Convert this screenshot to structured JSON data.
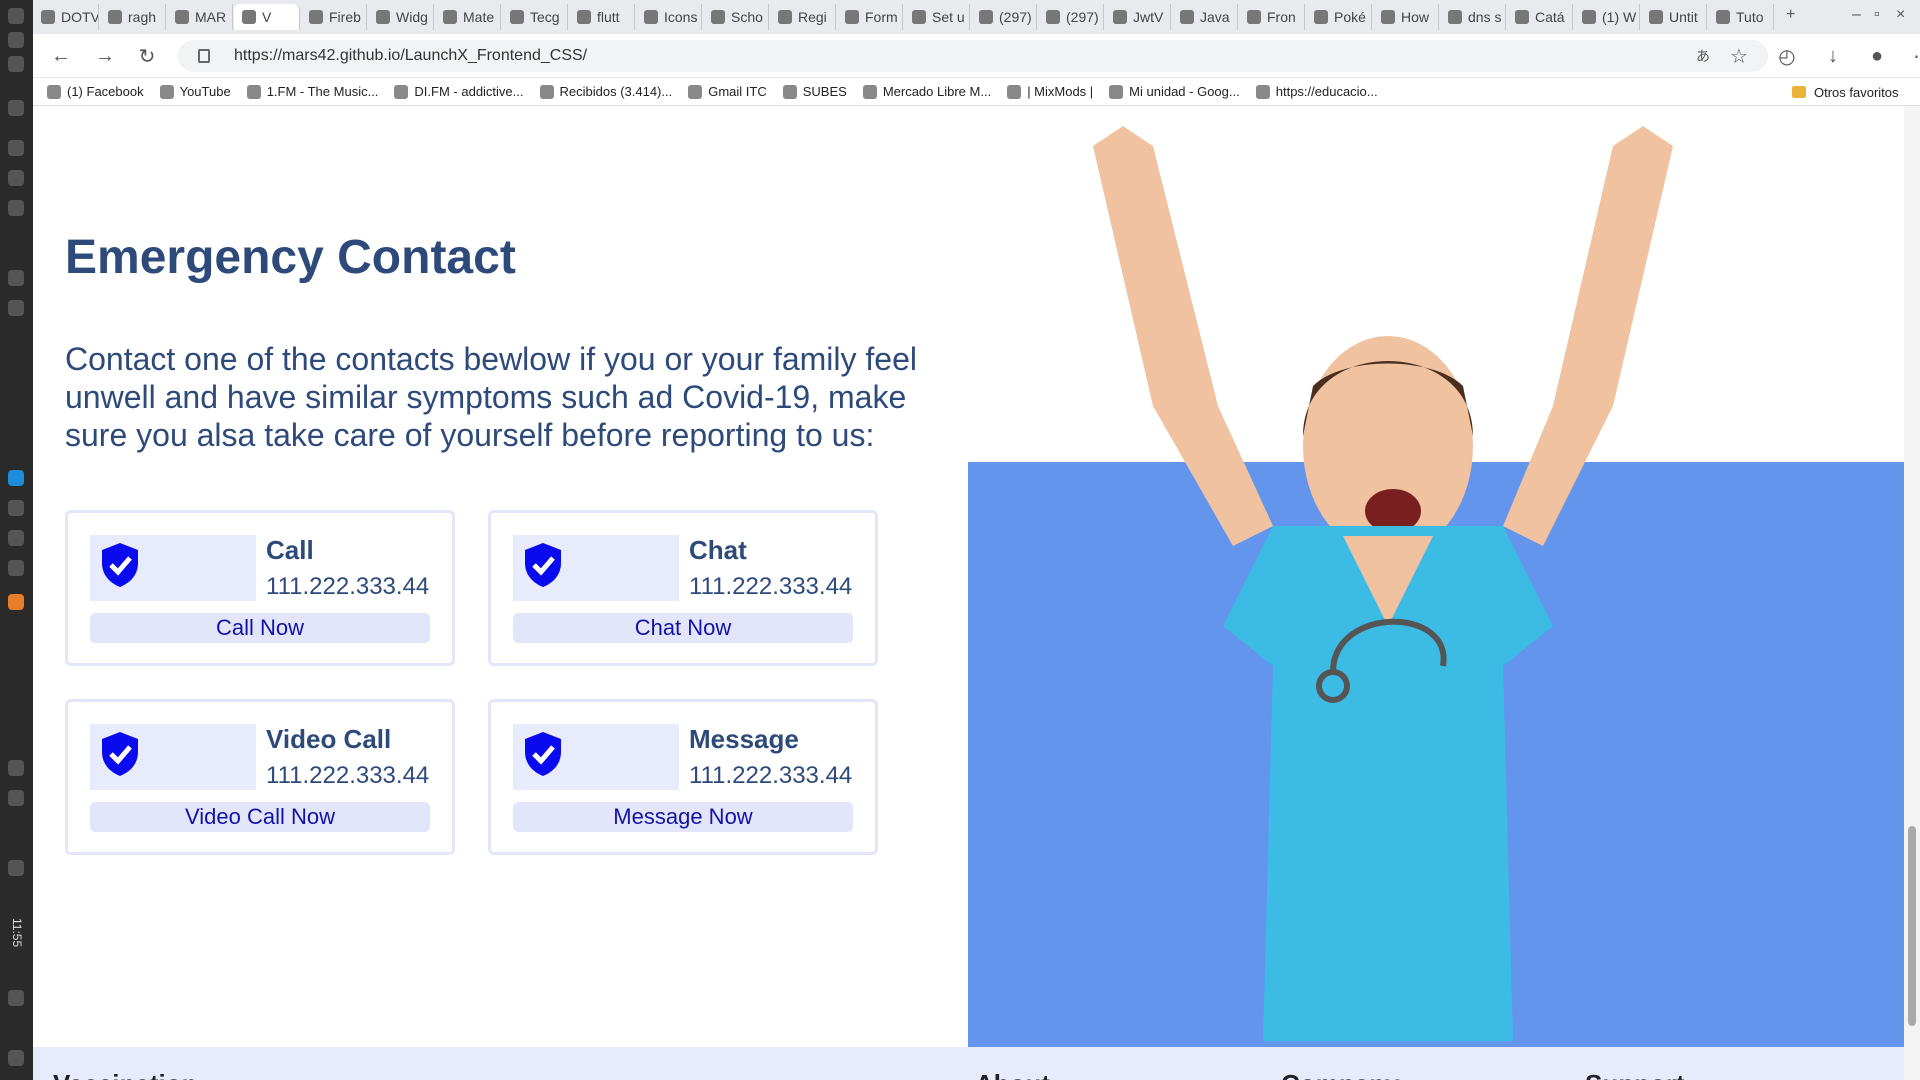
{
  "browser": {
    "tabs": [
      "DOTV",
      "ragh",
      "MAR",
      "V",
      "Fireb",
      "Widg",
      "Mate",
      "Tecg",
      "flutt",
      "Icons",
      "Scho",
      "Regi",
      "Form",
      "Set u",
      "(297)",
      "(297)",
      "JwtV",
      "Java",
      "Fron",
      "Poké",
      "How",
      "dns s",
      "Catá",
      "(1) W",
      "Untit",
      "Tuto"
    ],
    "url": "https://mars42.github.io/LaunchX_Frontend_CSS/",
    "bookmarks": [
      "(1) Facebook",
      "YouTube",
      "1.FM - The Music...",
      "DI.FM - addictive...",
      "Recibidos (3.414)...",
      "Gmail ITC",
      "SUBES",
      "Mercado Libre M...",
      "| MixMods |",
      "Mi unidad - Goog...",
      "https://educacio..."
    ],
    "other_bookmarks": "Otros favoritos",
    "clock": "11:55"
  },
  "page": {
    "title": "Emergency Contact",
    "intro": "Contact one of the contacts bewlow if you or your family feel unwell and have similar symptoms such ad Covid-19, make sure you alsa take care of yourself before reporting to us:",
    "cards": [
      {
        "title": "Call",
        "number": "111.222.333.44",
        "button": "Call Now"
      },
      {
        "title": "Chat",
        "number": "111.222.333.44",
        "button": "Chat Now"
      },
      {
        "title": "Video Call",
        "number": "111.222.333.44",
        "button": "Video Call Now"
      },
      {
        "title": "Message",
        "number": "111.222.333.44",
        "button": "Message Now"
      }
    ],
    "footer": [
      "Vaccination",
      "About",
      "Company",
      "Support"
    ]
  },
  "colors": {
    "heading": "#2d4a7a",
    "card_border": "#e3e6f9",
    "button_text": "#1212a8",
    "hero_bg": "#6495ed",
    "icon": "#0a0aee"
  },
  "icons": {
    "card_icon": "shield-check-icon",
    "hero": "nurse-illustration"
  }
}
